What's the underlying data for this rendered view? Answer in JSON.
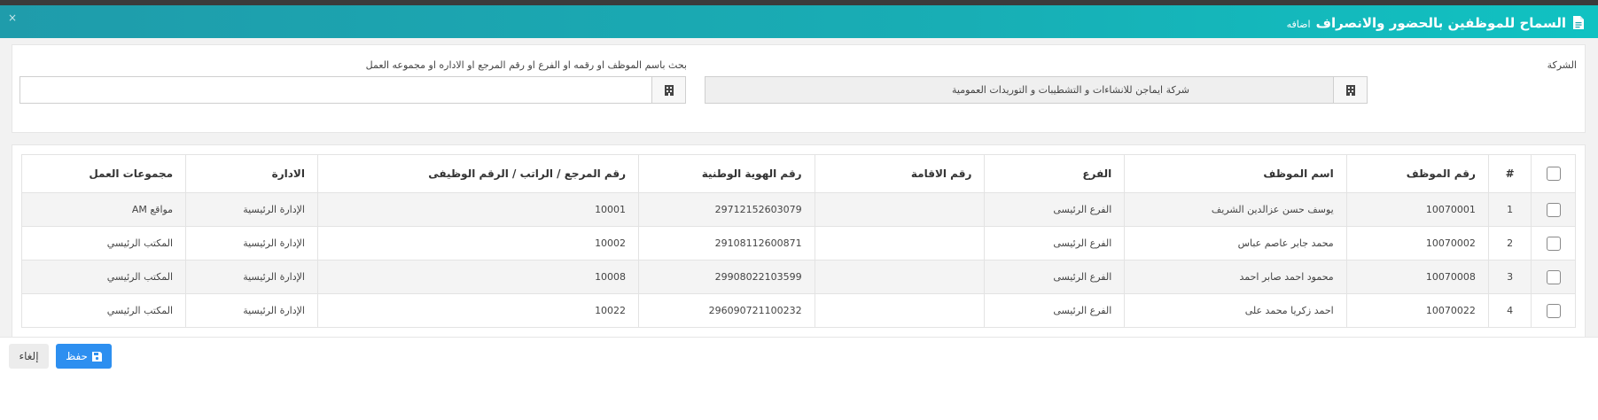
{
  "header": {
    "title": "السماح للموظفين بالحضور والانصراف",
    "subtitle": "اضافه",
    "close": "×"
  },
  "filters": {
    "company_label": "الشركة",
    "company_value": "شركة ايماجن للانشاءات و التشطيبات و التوريدات العمومية",
    "search_label": "بحث باسم الموظف او رقمه او الفرع او رقم المرجع او الاداره او مجموعه العمل",
    "search_value": "",
    "search_placeholder": ""
  },
  "table": {
    "headers": {
      "index": "#",
      "emp_no": "رقم الموظف",
      "name": "اسم الموظف",
      "branch": "الفرع",
      "residence": "رقم الاقامة",
      "national_id": "رقم الهوية الوطنية",
      "ref": "رقم المرجع / الراتب / الرقم الوظيفى",
      "dept": "الادارة",
      "groups": "مجموعات العمل"
    },
    "rows": [
      {
        "index": "1",
        "emp_no": "10070001",
        "name": "يوسف حسن عزالدين الشريف",
        "branch": "الفرع الرئيسى",
        "residence": "",
        "national_id": "29712152603079",
        "ref": "10001",
        "dept": "الإدارة الرئيسية",
        "groups": "مواقع AM"
      },
      {
        "index": "2",
        "emp_no": "10070002",
        "name": "محمد جابر عاصم عباس",
        "branch": "الفرع الرئيسى",
        "residence": "",
        "national_id": "29108112600871",
        "ref": "10002",
        "dept": "الإدارة الرئيسية",
        "groups": "المكتب الرئيسي"
      },
      {
        "index": "3",
        "emp_no": "10070008",
        "name": "محمود احمد صابر احمد",
        "branch": "الفرع الرئيسى",
        "residence": "",
        "national_id": "29908022103599",
        "ref": "10008",
        "dept": "الإدارة الرئيسية",
        "groups": "المكتب الرئيسي"
      },
      {
        "index": "4",
        "emp_no": "10070022",
        "name": "احمد زكريا محمد على",
        "branch": "الفرع الرئيسى",
        "residence": "",
        "national_id": "296090721100232",
        "ref": "10022",
        "dept": "الإدارة الرئيسية",
        "groups": "المكتب الرئيسي"
      }
    ]
  },
  "footer": {
    "save_label": "حفظ",
    "cancel_label": "إلغاء"
  },
  "icons": {
    "title": "document-icon",
    "company_field": "building-icon",
    "search_field": "building-icon",
    "save": "floppy-disk-icon"
  },
  "colors": {
    "header_start": "#1f9cab",
    "header_end": "#10c2c2",
    "save_button": "#2d8ff0"
  }
}
